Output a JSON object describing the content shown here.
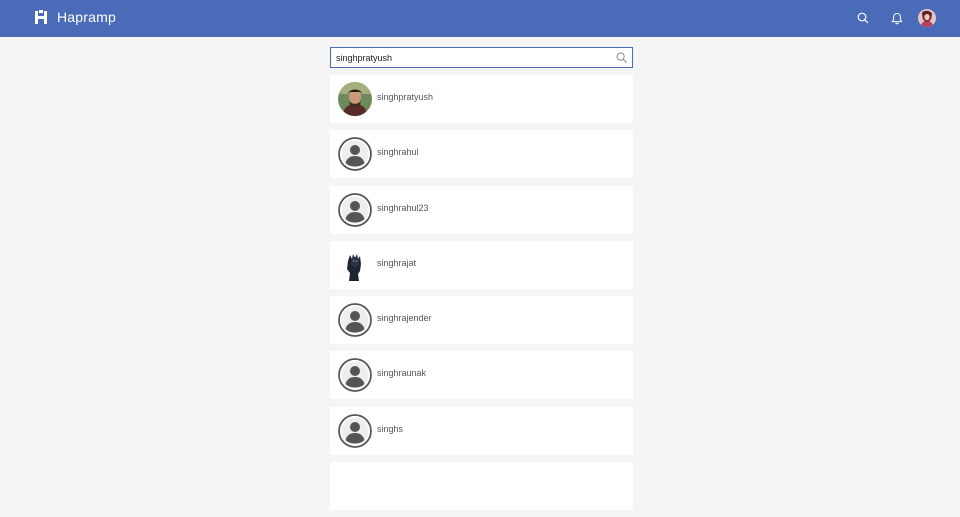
{
  "app": {
    "brand": "Hapramp",
    "colors": {
      "header": "#4a6bb8",
      "background": "#f5f5f5",
      "card": "#ffffff"
    }
  },
  "header": {
    "icons": [
      "logo-icon",
      "search-icon",
      "bell-icon",
      "user-avatar"
    ]
  },
  "search": {
    "value": "singhpratyush",
    "placeholder": ""
  },
  "results": [
    {
      "username": "singhpratyush",
      "avatar": "photo-person"
    },
    {
      "username": "singhrahul",
      "avatar": "default-user"
    },
    {
      "username": "singhrahul23",
      "avatar": "default-user"
    },
    {
      "username": "singhrajat",
      "avatar": "photo-black-figure"
    },
    {
      "username": "singhrajender",
      "avatar": "default-user"
    },
    {
      "username": "singhraunak",
      "avatar": "default-user"
    },
    {
      "username": "singhs",
      "avatar": "default-user"
    },
    {
      "username": "",
      "avatar": ""
    }
  ]
}
